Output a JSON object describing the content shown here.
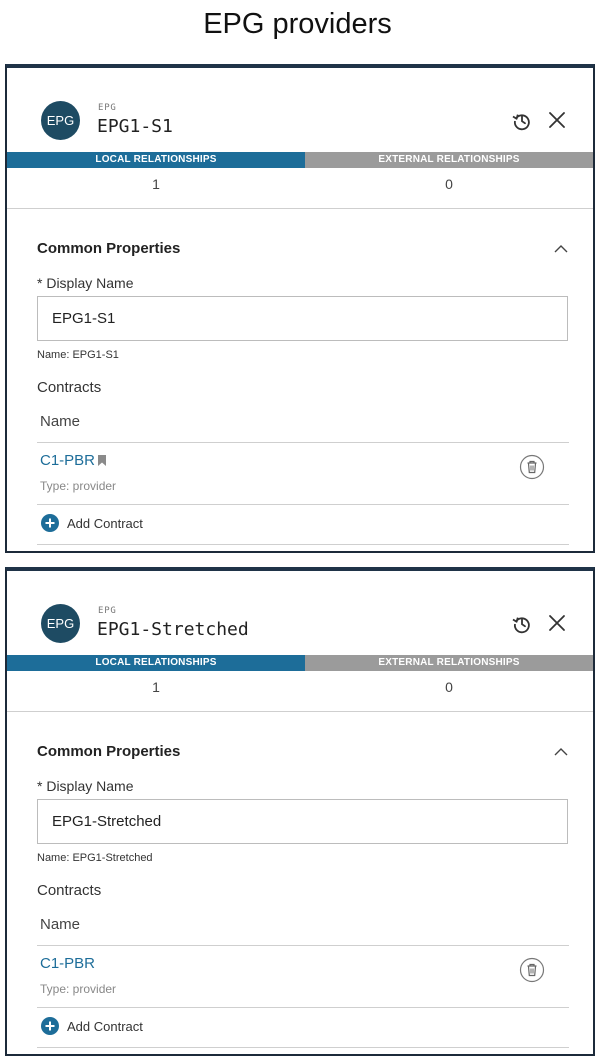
{
  "page": {
    "title": "EPG providers"
  },
  "panels": [
    {
      "avatar": "EPG",
      "type_label": "EPG",
      "name": "EPG1-S1",
      "tabs": {
        "local": "LOCAL RELATIONSHIPS",
        "external": "EXTERNAL RELATIONSHIPS"
      },
      "counts": {
        "local": "1",
        "external": "0"
      },
      "section_title": "Common Properties",
      "display_name_label": "* Display Name",
      "display_name_value": "EPG1-S1",
      "name_hint": "Name: EPG1-S1",
      "contracts_label": "Contracts",
      "column_header": "Name",
      "contract": {
        "name": "C1-PBR",
        "type": "Type: provider",
        "bookmarked": true
      },
      "add_contract_label": "Add Contract"
    },
    {
      "avatar": "EPG",
      "type_label": "EPG",
      "name": "EPG1-Stretched",
      "tabs": {
        "local": "LOCAL RELATIONSHIPS",
        "external": "EXTERNAL RELATIONSHIPS"
      },
      "counts": {
        "local": "1",
        "external": "0"
      },
      "section_title": "Common Properties",
      "display_name_label": "* Display Name",
      "display_name_value": "EPG1-Stretched",
      "name_hint": "Name: EPG1-Stretched",
      "contracts_label": "Contracts",
      "column_header": "Name",
      "contract": {
        "name": "C1-PBR",
        "type": "Type: provider",
        "bookmarked": false
      },
      "add_contract_label": "Add Contract"
    }
  ],
  "colors": {
    "accent": "#1d6d99",
    "avatar": "#1e4b63",
    "inactive_tab": "#9b9b9b",
    "panel_border": "#1f3348"
  },
  "icons": [
    "history-icon",
    "close-icon",
    "chevron-up-icon",
    "bookmark-icon",
    "trash-icon",
    "plus-circle-icon"
  ]
}
